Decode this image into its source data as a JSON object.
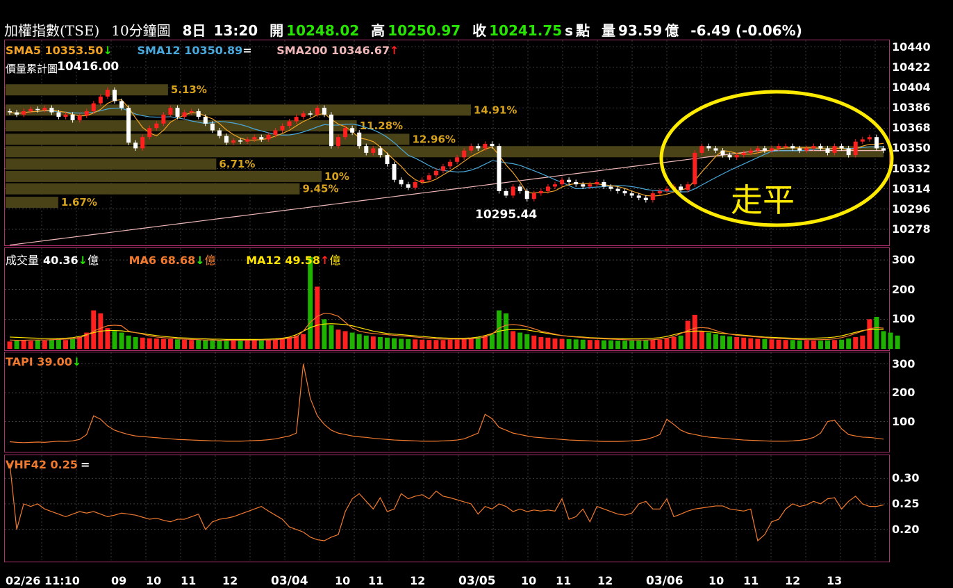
{
  "header": {
    "symbol": "加權指數(TSE)",
    "interval": "10分鐘圖",
    "date": "8日",
    "time": "13:20",
    "open_label": "開",
    "open": "10248.02",
    "high_label": "高",
    "high": "10250.97",
    "close_label": "收",
    "close": "10241.75",
    "close_suffix": "s",
    "points_label": "點",
    "volume_label": "量",
    "volume": "93.59",
    "volume_unit": "億",
    "change": "-6.49 (-0.06%)"
  },
  "colors": {
    "up": "#ff2020",
    "down": "#1fb200",
    "sma5": "#f2a324",
    "sma12": "#49a9dc",
    "sma200": "#f0b8b8",
    "orange": "#f27a2e",
    "yellow": "#ffe300",
    "band": "#4a4318",
    "ellipse": "#ffeb00"
  },
  "chart_data": [
    {
      "type": "candlestick",
      "name": "price",
      "legend": [
        {
          "label": "SMA5 10353.50",
          "arrow": "↓",
          "arrow_color": "#26e600",
          "color": "#f2a324"
        },
        {
          "label": "SMA12 10350.89",
          "arrow": "=",
          "arrow_color": "#ffffff",
          "color": "#49a9dc"
        },
        {
          "label": "SMA200 10346.67",
          "arrow": "↑",
          "arrow_color": "#ff2020",
          "color": "#f0b8b8"
        }
      ],
      "cumulative_label": "價量累計圖",
      "max_label": "10416.00",
      "min_label": "10295.44",
      "yticks": [
        10440,
        10422,
        10404,
        10386,
        10368,
        10350,
        10332,
        10314,
        10296,
        10278
      ],
      "ylim": [
        10265,
        10446
      ],
      "x_count": 126,
      "volume_profile": [
        {
          "price": 10402,
          "pct": "5.13%",
          "w": 0.185
        },
        {
          "price": 10384,
          "pct": "14.91%",
          "w": 0.53
        },
        {
          "price": 10370,
          "pct": "11.28%",
          "w": 0.4
        },
        {
          "price": 10358,
          "pct": "12.96%",
          "w": 0.46
        },
        {
          "price": 10347,
          "pct": "",
          "w": 1.0
        },
        {
          "price": 10336,
          "pct": "6.71%",
          "w": 0.24
        },
        {
          "price": 10325,
          "pct": "10%",
          "w": 0.36
        },
        {
          "price": 10314,
          "pct": "9.45%",
          "w": 0.335
        },
        {
          "price": 10302,
          "pct": "1.67%",
          "w": 0.06
        }
      ],
      "close": [
        10382,
        10380,
        10383,
        10385,
        10384,
        10386,
        10382,
        10378,
        10380,
        10375,
        10379,
        10383,
        10390,
        10396,
        10402,
        10392,
        10386,
        10355,
        10350,
        10360,
        10368,
        10372,
        10380,
        10386,
        10378,
        10382,
        10383,
        10378,
        10372,
        10366,
        10361,
        10355,
        10357,
        10356,
        10358,
        10360,
        10358,
        10362,
        10366,
        10370,
        10374,
        10378,
        10381,
        10380,
        10386,
        10380,
        10352,
        10360,
        10368,
        10364,
        10352,
        10346,
        10350,
        10344,
        10336,
        10322,
        10318,
        10315,
        10320,
        10322,
        10326,
        10330,
        10334,
        10338,
        10342,
        10348,
        10352,
        10350,
        10354,
        10352,
        10312,
        10308,
        10316,
        10312,
        10305,
        10310,
        10312,
        10316,
        10318,
        10322,
        10320,
        10318,
        10316,
        10318,
        10320,
        10316,
        10314,
        10312,
        10310,
        10308,
        10306,
        10304,
        10310,
        10312,
        10314,
        10316,
        10313,
        10318,
        10346,
        10352,
        10350,
        10348,
        10344,
        10342,
        10344,
        10346,
        10348,
        10350,
        10348,
        10350,
        10352,
        10352,
        10350,
        10348,
        10350,
        10352,
        10350,
        10346,
        10352,
        10350,
        10344,
        10356,
        10358,
        10360,
        10350,
        10348
      ],
      "sma200_start": 10264,
      "sma200_end": 10348
    },
    {
      "type": "bar",
      "name": "volume",
      "legend": [
        {
          "label": "成交量",
          "value": "40.36",
          "arrow": "↓",
          "arrow_color": "#26e600",
          "unit": "億",
          "color": "#ffffff"
        },
        {
          "label": "MA6 68.68",
          "arrow": "↓",
          "arrow_color": "#26e600",
          "unit": "億",
          "color": "#f27a2e"
        },
        {
          "label": "MA12 49.58",
          "arrow": "↑",
          "arrow_color": "#ff2020",
          "unit": "億",
          "color": "#ffe300"
        }
      ],
      "yticks": [
        300,
        200,
        100
      ],
      "ylim": [
        0,
        340
      ],
      "values": [
        25,
        28,
        30,
        27,
        30,
        28,
        32,
        34,
        30,
        35,
        40,
        55,
        130,
        120,
        70,
        60,
        55,
        45,
        40,
        38,
        36,
        35,
        34,
        33,
        32,
        31,
        30,
        30,
        29,
        29,
        28,
        28,
        28,
        28,
        29,
        30,
        30,
        31,
        32,
        35,
        40,
        45,
        50,
        310,
        210,
        100,
        80,
        65,
        60,
        55,
        50,
        45,
        42,
        40,
        38,
        36,
        34,
        33,
        32,
        31,
        30,
        30,
        30,
        31,
        31,
        32,
        35,
        40,
        45,
        50,
        130,
        120,
        60,
        55,
        50,
        45,
        40,
        38,
        35,
        34,
        33,
        32,
        31,
        30,
        30,
        29,
        29,
        28,
        28,
        28,
        28,
        29,
        30,
        31,
        35,
        40,
        45,
        95,
        115,
        60,
        55,
        50,
        45,
        42,
        40,
        38,
        36,
        34,
        33,
        32,
        31,
        30,
        30,
        29,
        29,
        28,
        28,
        29,
        30,
        31,
        35,
        40,
        45,
        100,
        108,
        60,
        55,
        45
      ],
      "ma6": [
        30,
        29,
        29,
        30,
        30,
        30,
        31,
        32,
        33,
        34,
        38,
        46,
        60,
        70,
        78,
        80,
        78,
        60,
        55,
        50,
        44,
        40,
        38,
        36,
        34,
        33,
        32,
        31,
        30,
        30,
        29,
        29,
        29,
        29,
        29,
        29,
        30,
        30,
        31,
        33,
        36,
        40,
        60,
        90,
        110,
        120,
        118,
        110,
        90,
        70,
        60,
        55,
        52,
        50,
        48,
        46,
        44,
        42,
        40,
        38,
        36,
        34,
        33,
        33,
        33,
        33,
        34,
        36,
        40,
        50,
        70,
        80,
        82,
        80,
        75,
        68,
        60,
        55,
        50,
        45,
        42,
        40,
        38,
        36,
        35,
        34,
        33,
        32,
        31,
        30,
        30,
        30,
        31,
        33,
        36,
        42,
        52,
        62,
        70,
        72,
        70,
        62,
        55,
        50,
        46,
        44,
        42,
        40,
        38,
        36,
        35,
        34,
        33,
        32,
        31,
        31,
        31,
        32,
        34,
        38,
        44,
        52,
        60,
        68,
        72,
        70
      ],
      "ma12": [
        40,
        39,
        38,
        37,
        36,
        35,
        35,
        35,
        36,
        38,
        42,
        48,
        55,
        60,
        62,
        62,
        61,
        58,
        55,
        52,
        48,
        45,
        42,
        40,
        38,
        37,
        36,
        35,
        34,
        33,
        33,
        32,
        32,
        32,
        32,
        32,
        32,
        33,
        34,
        36,
        40,
        48,
        60,
        72,
        80,
        84,
        85,
        84,
        82,
        78,
        72,
        66,
        60,
        56,
        52,
        50,
        48,
        46,
        44,
        42,
        40,
        38,
        37,
        36,
        36,
        36,
        37,
        40,
        45,
        52,
        60,
        64,
        66,
        66,
        64,
        60,
        56,
        52,
        48,
        45,
        43,
        41,
        40,
        38,
        37,
        36,
        35,
        35,
        34,
        34,
        34,
        35,
        36,
        38,
        42,
        48,
        54,
        58,
        60,
        60,
        58,
        55,
        52,
        50,
        48,
        46,
        44,
        42,
        40,
        39,
        38,
        37,
        36,
        36,
        36,
        36,
        37,
        38,
        40,
        44,
        50,
        56,
        62,
        65,
        66,
        66
      ]
    },
    {
      "type": "line",
      "name": "TAPI",
      "legend": [
        {
          "label": "TAPI 39.00",
          "arrow": "↓",
          "arrow_color": "#26e600",
          "color": "#f27a2e"
        }
      ],
      "yticks": [
        300,
        200,
        100
      ],
      "ylim": [
        0,
        340
      ],
      "values": [
        30,
        28,
        27,
        28,
        29,
        28,
        30,
        32,
        31,
        33,
        38,
        55,
        120,
        108,
        85,
        70,
        62,
        55,
        50,
        48,
        46,
        44,
        42,
        40,
        38,
        37,
        36,
        35,
        34,
        33,
        33,
        32,
        32,
        32,
        33,
        34,
        35,
        37,
        40,
        45,
        50,
        60,
        300,
        180,
        120,
        90,
        70,
        60,
        55,
        50,
        47,
        45,
        42,
        40,
        38,
        36,
        35,
        34,
        33,
        32,
        32,
        32,
        33,
        34,
        36,
        40,
        50,
        60,
        125,
        110,
        80,
        70,
        60,
        55,
        50,
        46,
        44,
        42,
        40,
        38,
        36,
        35,
        34,
        33,
        32,
        31,
        31,
        31,
        32,
        33,
        35,
        38,
        45,
        55,
        108,
        90,
        70,
        60,
        55,
        50,
        46,
        44,
        42,
        40,
        38,
        36,
        35,
        34,
        33,
        32,
        32,
        32,
        33,
        35,
        38,
        45,
        60,
        100,
        105,
        75,
        55,
        50,
        46,
        45,
        42,
        39
      ]
    },
    {
      "type": "line",
      "name": "VHF42",
      "legend": [
        {
          "label": "VHF42 0.25",
          "arrow": "=",
          "arrow_color": "#ffffff",
          "color": "#f27a2e"
        }
      ],
      "yticks": [
        "0.30",
        "0.25",
        "0.20"
      ],
      "ylim": [
        0.14,
        0.345
      ],
      "values": [
        0.33,
        0.2,
        0.25,
        0.245,
        0.25,
        0.24,
        0.235,
        0.23,
        0.225,
        0.23,
        0.235,
        0.232,
        0.235,
        0.23,
        0.225,
        0.228,
        0.232,
        0.23,
        0.228,
        0.224,
        0.22,
        0.222,
        0.218,
        0.215,
        0.22,
        0.22,
        0.225,
        0.23,
        0.2,
        0.215,
        0.22,
        0.222,
        0.225,
        0.23,
        0.235,
        0.24,
        0.245,
        0.236,
        0.228,
        0.22,
        0.205,
        0.2,
        0.195,
        0.185,
        0.18,
        0.178,
        0.185,
        0.19,
        0.235,
        0.26,
        0.27,
        0.255,
        0.24,
        0.262,
        0.235,
        0.24,
        0.27,
        0.26,
        0.265,
        0.268,
        0.26,
        0.275,
        0.265,
        0.262,
        0.258,
        0.254,
        0.25,
        0.23,
        0.245,
        0.24,
        0.25,
        0.245,
        0.235,
        0.24,
        0.235,
        0.238,
        0.236,
        0.238,
        0.236,
        0.26,
        0.22,
        0.225,
        0.24,
        0.215,
        0.245,
        0.24,
        0.235,
        0.23,
        0.228,
        0.232,
        0.25,
        0.255,
        0.24,
        0.24,
        0.26,
        0.225,
        0.23,
        0.236,
        0.24,
        0.242,
        0.244,
        0.246,
        0.246,
        0.24,
        0.238,
        0.236,
        0.24,
        0.178,
        0.19,
        0.215,
        0.22,
        0.24,
        0.25,
        0.245,
        0.248,
        0.255,
        0.25,
        0.26,
        0.262,
        0.24,
        0.255,
        0.265,
        0.25,
        0.245,
        0.245,
        0.248
      ]
    }
  ],
  "xaxis_labels": [
    "02/26 11:10",
    "09",
    "10",
    "11",
    "12",
    "03/04",
    "10",
    "11",
    "12",
    "03/05",
    "10",
    "11",
    "12",
    "03/06",
    "10",
    "11",
    "12",
    "13"
  ],
  "annotation": {
    "text": "走平"
  }
}
